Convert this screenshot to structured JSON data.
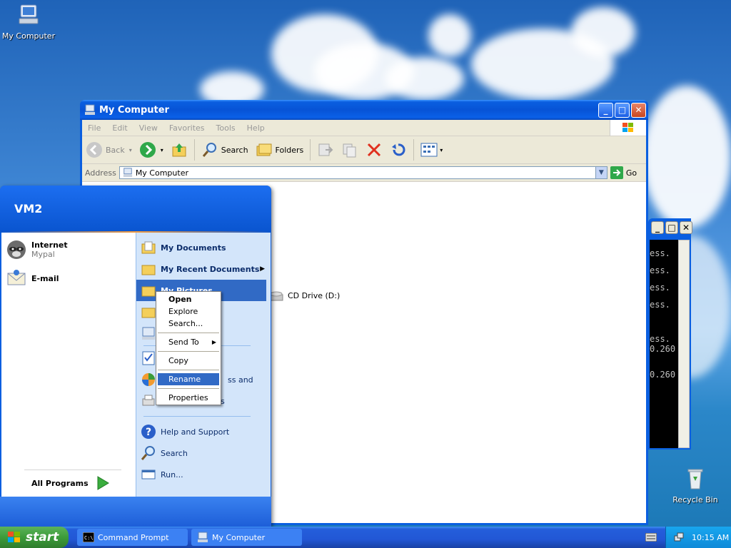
{
  "desktop": {
    "icons": [
      {
        "label": "My Computer",
        "icon": "computer-icon"
      },
      {
        "label": "Recycle Bin",
        "icon": "recycle-bin-icon"
      }
    ]
  },
  "explorer": {
    "title": "My Computer",
    "menu": [
      "File",
      "Edit",
      "View",
      "Favorites",
      "Tools",
      "Help"
    ],
    "toolbar": {
      "back": "Back",
      "search": "Search",
      "folders": "Folders"
    },
    "address_label": "Address",
    "address_value": "My Computer",
    "go": "Go",
    "items": [
      {
        "label": "CD Drive (D:)",
        "icon": "cd-drive-icon"
      }
    ]
  },
  "console": {
    "lines": [
      "ess.",
      "ess.",
      "ess.",
      "ess.",
      "ess.",
      "0.260",
      "0.260"
    ]
  },
  "start_menu": {
    "user": "VM2",
    "pinned": [
      {
        "title": "Internet",
        "subtitle": "Mypal",
        "icon": "raccoon-browser-icon"
      },
      {
        "title": "E-mail",
        "subtitle": "",
        "icon": "mail-icon"
      }
    ],
    "all_programs": "All Programs",
    "right": {
      "my_documents": "My Documents",
      "recent_documents": "My Recent Documents",
      "my_pictures": "My Pictures",
      "partial_1": "ss and",
      "partial_2": "s",
      "help": "Help and Support",
      "search": "Search",
      "run": "Run..."
    }
  },
  "context_menu": {
    "items": [
      "Open",
      "Explore",
      "Search...",
      "Send To",
      "Copy",
      "Rename",
      "Properties"
    ]
  },
  "taskbar": {
    "start": "start",
    "tasks": [
      {
        "label": "Command Prompt",
        "icon": "cmd-icon"
      },
      {
        "label": "My Computer",
        "icon": "computer-icon"
      }
    ],
    "clock": "10:15 AM"
  },
  "colors": {
    "xp_blue": "#0a5fe0",
    "start_green": "#3c9b3a",
    "selection": "#316ac5"
  }
}
